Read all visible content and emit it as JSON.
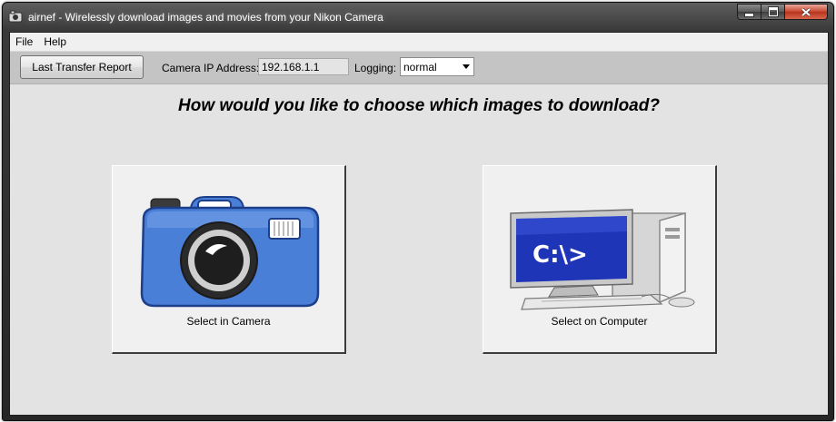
{
  "window": {
    "title": "airnef - Wirelessly download images and movies from your Nikon Camera",
    "app_icon": "camera-icon",
    "caption_buttons": {
      "minimize_icon": "minimize-icon",
      "maximize_icon": "maximize-icon",
      "close_icon": "close-icon"
    }
  },
  "menu": {
    "file": "File",
    "help": "Help"
  },
  "toolbar": {
    "report_button": "Last Transfer Report",
    "ip_label": "Camera IP Address:",
    "ip_value": "192.168.1.1",
    "logging_label": "Logging:",
    "logging_value": "normal"
  },
  "main": {
    "question": "How would you like to choose which images to download?",
    "choices": [
      {
        "label": "Select in Camera",
        "icon": "camera-icon"
      },
      {
        "label": "Select on Computer",
        "icon": "computer-icon",
        "screen_text": "C:\\>"
      }
    ]
  },
  "colors": {
    "camera_blue": "#4a7fd8",
    "screen_blue": "#1f35b8",
    "close_red": "#c7452e"
  }
}
